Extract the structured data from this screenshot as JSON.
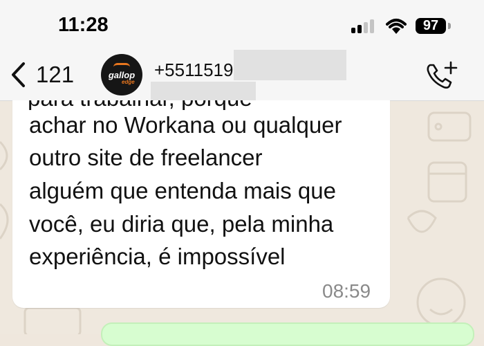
{
  "status_bar": {
    "time": "11:28",
    "battery": "97"
  },
  "header": {
    "back_count": "121",
    "contact_name": "+5511519",
    "avatar_text": "gallop",
    "avatar_subtext": "edge"
  },
  "message": {
    "cut_line": "para trabalhar, porque",
    "lines": [
      "achar no Workana ou qualquer",
      "outro site de freelancer",
      "alguém que entenda mais que",
      "você, eu diria que, pela minha",
      "experiência, é impossível"
    ],
    "time": "08:59"
  },
  "colors": {
    "chat_bg": "#efe8de",
    "bubble": "#ffffff",
    "outgoing": "#d7fdd0"
  }
}
